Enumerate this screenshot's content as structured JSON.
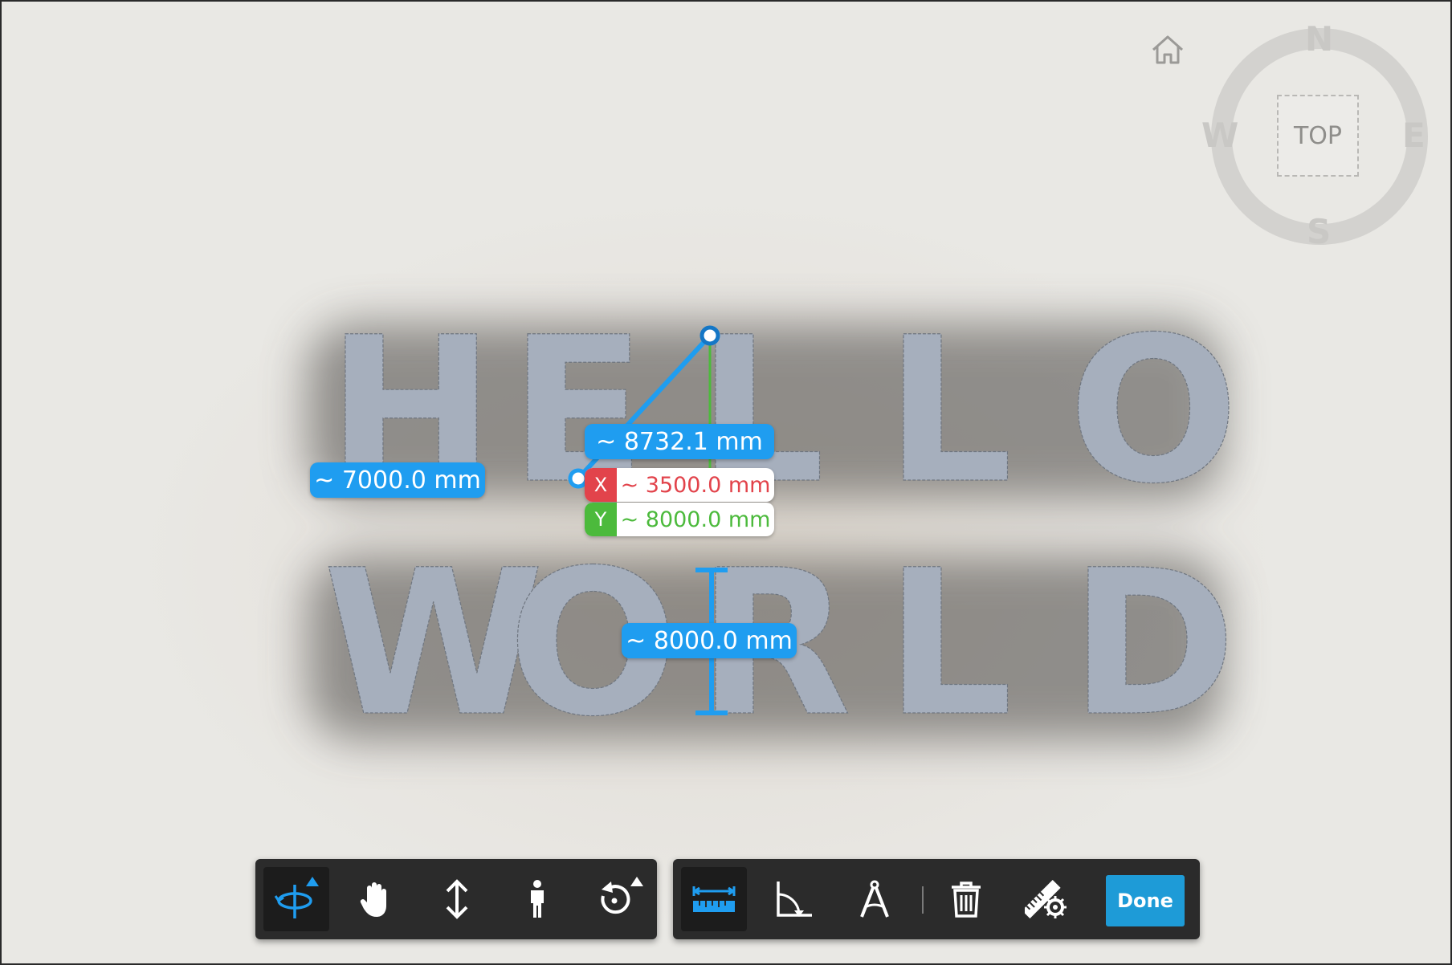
{
  "scene": {
    "row1_letters": [
      "H",
      "E",
      "L",
      "L",
      "O"
    ],
    "row2_letters": [
      "W",
      "O",
      "R",
      "L",
      "D"
    ]
  },
  "compass": {
    "north": "N",
    "south": "S",
    "east": "E",
    "west": "W",
    "view_cube_label": "TOP",
    "home_icon": "home-icon"
  },
  "measurements": {
    "width_label": "~ 7000.0 mm",
    "diagonal_label": "~ 8732.1 mm",
    "x_axis_tag": "X",
    "x_value": "~ 3500.0 mm",
    "y_axis_tag": "Y",
    "y_value": "~ 8000.0 mm",
    "height_label": "~ 8000.0 mm"
  },
  "toolbar_nav": {
    "tools": [
      {
        "name": "orbit-icon",
        "active": true
      },
      {
        "name": "pan-icon",
        "active": false
      },
      {
        "name": "zoom-icon",
        "active": false
      },
      {
        "name": "first-person-icon",
        "active": false
      },
      {
        "name": "reset-view-icon",
        "active": false
      }
    ]
  },
  "toolbar_measure": {
    "tools": [
      {
        "name": "measure-distance-icon",
        "active": true
      },
      {
        "name": "measure-angle-icon",
        "active": false
      },
      {
        "name": "measure-area-icon",
        "active": false
      },
      {
        "name": "delete-icon",
        "active": false
      },
      {
        "name": "measure-settings-icon",
        "active": false
      }
    ],
    "done_label": "Done"
  },
  "colors": {
    "accent_blue": "#1f9df0",
    "x_axis_red": "#e2434b",
    "y_axis_green": "#4cba3c",
    "toolbar_bg": "#2b2b2b",
    "letter_fill": "#a6afbd"
  }
}
